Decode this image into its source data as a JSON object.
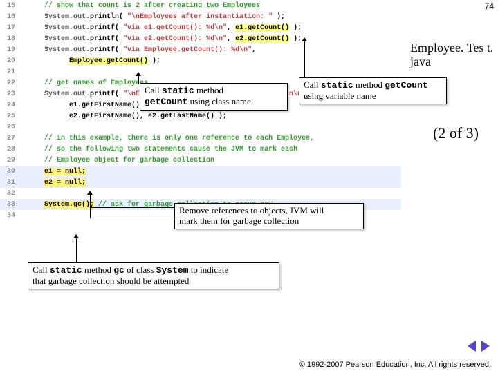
{
  "page_number": "74",
  "title": "Employee. Tes t. java",
  "pager": "(2 of  3)",
  "callouts": {
    "classname": {
      "pre": "Call ",
      "m1": "static",
      "mid": " method ",
      "m2": "getCount",
      "post": " using class name"
    },
    "varname": {
      "pre": "Call ",
      "m1": "static",
      "mid": " method ",
      "m2": "getCount",
      "post": " using variable name"
    },
    "remove": {
      "l1": "Remove references to objects, JVM will",
      "l2": "mark them for garbage collection"
    },
    "gc": {
      "pre": "Call ",
      "m1": "static",
      "mid": " method ",
      "m2": "gc",
      "mid2": " of class ",
      "m3": "System",
      "post": " to indicate",
      "l2": "that garbage collection should be attempted"
    }
  },
  "copyright": "© 1992-2007 Pearson Education, Inc. All rights reserved.",
  "code": [
    {
      "n": "15",
      "indent": 3,
      "html": "<span class='tok-comment'>// show that count is 2 after creating two Employees</span>"
    },
    {
      "n": "16",
      "indent": 3,
      "html": "<span class='tok-sys'>System.out.</span><span class='tok-plain'>println( </span><span class='tok-str'>\"\\nEmployees after instantiation: \"</span><span class='tok-plain'> );</span>"
    },
    {
      "n": "17",
      "indent": 3,
      "html": "<span class='tok-sys'>System.out.</span><span class='tok-plain'>printf( </span><span class='tok-str'>\"via e1.getCount(): %d\\n\"</span><span class='tok-plain'>, </span><span class='tok-hl'>e1.getCount()</span><span class='tok-plain'> );</span>"
    },
    {
      "n": "18",
      "indent": 3,
      "html": "<span class='tok-sys'>System.out.</span><span class='tok-plain'>printf( </span><span class='tok-str'>\"via e2.getCount(): %d\\n\"</span><span class='tok-plain'>, </span><span class='tok-hl'>e2.getCount()</span><span class='tok-plain'> );</span>"
    },
    {
      "n": "19",
      "indent": 3,
      "html": "<span class='tok-sys'>System.out.</span><span class='tok-plain'>printf( </span><span class='tok-str'>\"via Employee.getCount(): %d\\n\"</span><span class='tok-plain'>,</span>"
    },
    {
      "n": "20",
      "indent": 6,
      "html": "<span class='tok-hl'>Employee.getCount()</span><span class='tok-plain'> );</span>"
    },
    {
      "n": "21",
      "indent": 0,
      "html": ""
    },
    {
      "n": "22",
      "indent": 3,
      "html": "<span class='tok-comment'>// get names of Employees</span>"
    },
    {
      "n": "23",
      "indent": 3,
      "html": "<span class='tok-sys'>System.out.</span><span class='tok-plain'>printf( </span><span class='tok-str'>\"\\nEmployee 1: %s %s\\nEmployee 2: %s %s\\n\\n\"</span><span class='tok-plain'>,</span>"
    },
    {
      "n": "24",
      "indent": 6,
      "html": "<span class='tok-plain'>e1.getFirstName(), e1.getLastName(),</span>"
    },
    {
      "n": "25",
      "indent": 6,
      "html": "<span class='tok-plain'>e2.getFirstName(), e2.getLastName() );</span>"
    },
    {
      "n": "26",
      "indent": 0,
      "html": ""
    },
    {
      "n": "27",
      "indent": 3,
      "html": "<span class='tok-comment'>// in this example, there is only one reference to each Employee,</span>"
    },
    {
      "n": "28",
      "indent": 3,
      "html": "<span class='tok-comment'>// so the following two statements cause the JVM to mark each</span>"
    },
    {
      "n": "29",
      "indent": 3,
      "html": "<span class='tok-comment'>// Employee object for garbage collection</span>"
    },
    {
      "n": "30",
      "indent": 3,
      "html": "<span class='tok-hl2'>e1 = null;</span>",
      "hl": true
    },
    {
      "n": "31",
      "indent": 3,
      "html": "<span class='tok-hl2'>e2 = null;</span>",
      "hl": true
    },
    {
      "n": "32",
      "indent": 0,
      "html": ""
    },
    {
      "n": "33",
      "indent": 3,
      "html": "<span class='tok-hl2'>System.gc();</span> <span class='tok-comment'>// ask for garbage collection to occur now</span>",
      "hl": true
    },
    {
      "n": "34",
      "indent": 0,
      "html": ""
    }
  ]
}
